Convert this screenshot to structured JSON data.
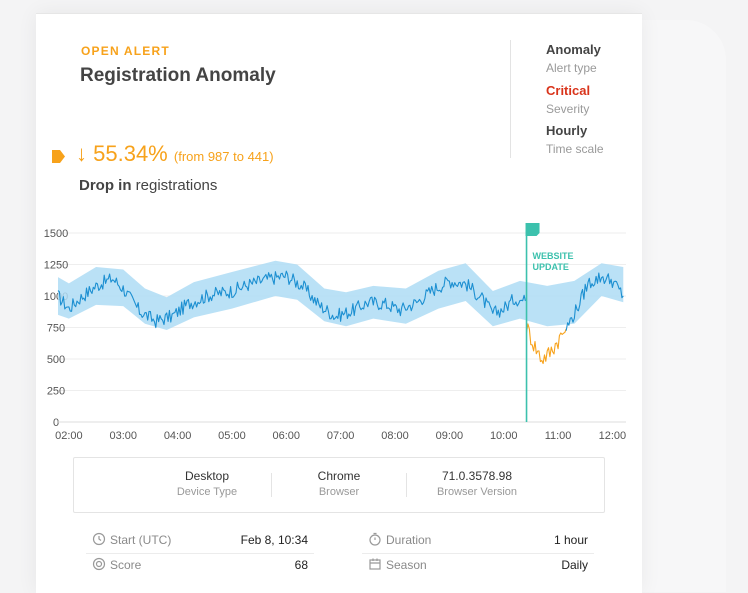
{
  "alert": {
    "status": "OPEN ALERT",
    "title": "Registration Anomaly"
  },
  "meta": [
    {
      "value": "Anomaly",
      "label": "Alert type"
    },
    {
      "value": "Critical",
      "label": "Severity",
      "color": "#d9341b"
    },
    {
      "value": "Hourly",
      "label": "Time scale"
    }
  ],
  "change": {
    "arrow": "↓",
    "percent": "55.34%",
    "from_to": "(from 987 to 441)",
    "desc_bold": "Drop in",
    "desc_rest": "registrations"
  },
  "colors": {
    "accent": "#f7a21b",
    "series": "#1c8fd1",
    "band": "#aedcf4",
    "event": "#3cc1ad",
    "critical": "#d9341b"
  },
  "chart_data": {
    "type": "line",
    "x_ticks": [
      "02:00",
      "03:00",
      "04:00",
      "05:00",
      "06:00",
      "07:00",
      "08:00",
      "09:00",
      "10:00",
      "11:00",
      "12:00"
    ],
    "y_ticks": [
      "1500",
      "1250",
      "1000",
      "750",
      "500",
      "250",
      "0"
    ],
    "ylim": [
      0,
      1500
    ],
    "grid": true,
    "event": {
      "label_line1": "WEBSITE",
      "label_line2": "UPDATE",
      "time_hours": 10.42
    },
    "series": [
      {
        "points": [
          [
            1.8,
            1000
          ],
          [
            2.0,
            900
          ],
          [
            2.2,
            980
          ],
          [
            2.5,
            1080
          ],
          [
            2.8,
            1140
          ],
          [
            3.0,
            1060
          ],
          [
            3.3,
            880
          ],
          [
            3.6,
            800
          ],
          [
            3.9,
            840
          ],
          [
            4.2,
            940
          ],
          [
            4.6,
            1010
          ],
          [
            5.0,
            1040
          ],
          [
            5.3,
            1090
          ],
          [
            5.7,
            1140
          ],
          [
            6.0,
            1160
          ],
          [
            6.3,
            1080
          ],
          [
            6.6,
            930
          ],
          [
            6.9,
            840
          ],
          [
            7.2,
            880
          ],
          [
            7.5,
            950
          ],
          [
            7.8,
            940
          ],
          [
            8.1,
            890
          ],
          [
            8.4,
            950
          ],
          [
            8.7,
            1050
          ],
          [
            9.0,
            1120
          ],
          [
            9.3,
            1100
          ],
          [
            9.6,
            980
          ],
          [
            9.8,
            860
          ],
          [
            10.0,
            900
          ],
          [
            10.2,
            980
          ],
          [
            10.4,
            960
          ]
        ]
      },
      {
        "name": "anomaly",
        "points": [
          [
            10.42,
            760
          ],
          [
            10.55,
            620
          ],
          [
            10.7,
            500
          ],
          [
            10.85,
            550
          ],
          [
            11.0,
            650
          ],
          [
            11.15,
            740
          ]
        ]
      },
      {
        "points": [
          [
            11.15,
            740
          ],
          [
            11.35,
            900
          ],
          [
            11.55,
            1100
          ],
          [
            11.8,
            1150
          ],
          [
            12.0,
            1120
          ],
          [
            12.2,
            1000
          ]
        ]
      }
    ],
    "band": [
      {
        "x": 1.8,
        "lower": 850,
        "upper": 1150
      },
      {
        "x": 2.0,
        "lower": 820,
        "upper": 1100
      },
      {
        "x": 2.5,
        "lower": 930,
        "upper": 1230
      },
      {
        "x": 3.0,
        "lower": 920,
        "upper": 1210
      },
      {
        "x": 3.4,
        "lower": 780,
        "upper": 1060
      },
      {
        "x": 3.8,
        "lower": 730,
        "upper": 990
      },
      {
        "x": 4.3,
        "lower": 830,
        "upper": 1110
      },
      {
        "x": 5.0,
        "lower": 900,
        "upper": 1190
      },
      {
        "x": 5.8,
        "lower": 1000,
        "upper": 1280
      },
      {
        "x": 6.2,
        "lower": 970,
        "upper": 1250
      },
      {
        "x": 6.7,
        "lower": 800,
        "upper": 1060
      },
      {
        "x": 7.1,
        "lower": 760,
        "upper": 1030
      },
      {
        "x": 7.6,
        "lower": 820,
        "upper": 1080
      },
      {
        "x": 8.2,
        "lower": 780,
        "upper": 1060
      },
      {
        "x": 8.8,
        "lower": 900,
        "upper": 1200
      },
      {
        "x": 9.3,
        "lower": 960,
        "upper": 1260
      },
      {
        "x": 9.8,
        "lower": 760,
        "upper": 1040
      },
      {
        "x": 10.3,
        "lower": 820,
        "upper": 1120
      },
      {
        "x": 10.8,
        "lower": 760,
        "upper": 1080
      },
      {
        "x": 11.3,
        "lower": 780,
        "upper": 1120
      },
      {
        "x": 11.8,
        "lower": 1000,
        "upper": 1260
      },
      {
        "x": 12.2,
        "lower": 950,
        "upper": 1230
      }
    ]
  },
  "dimensions": [
    {
      "value": "Desktop",
      "label": "Device Type"
    },
    {
      "value": "Chrome",
      "label": "Browser"
    },
    {
      "value": "71.0.3578.98",
      "label": "Browser Version"
    }
  ],
  "details": {
    "start": {
      "label": "Start (UTC)",
      "value": "Feb 8, 10:34",
      "icon": "clock-icon"
    },
    "duration": {
      "label": "Duration",
      "value": "1 hour",
      "icon": "stopwatch-icon"
    },
    "score": {
      "label": "Score",
      "value": "68",
      "icon": "score-icon"
    },
    "season": {
      "label": "Season",
      "value": "Daily",
      "icon": "calendar-icon"
    }
  }
}
